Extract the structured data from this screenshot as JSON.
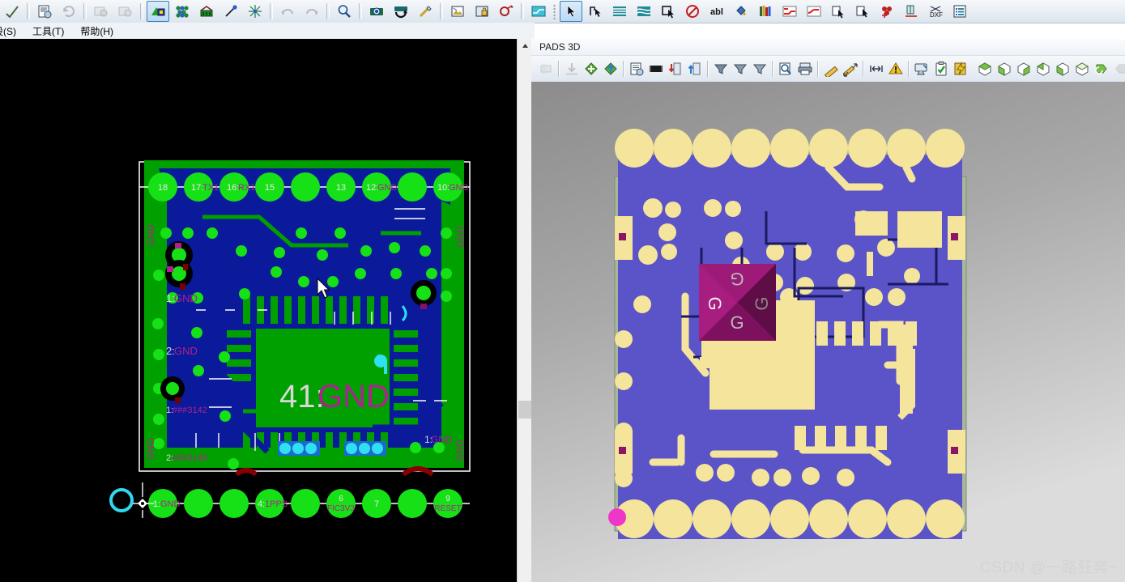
{
  "menubar": {
    "items": [
      {
        "label": "设(S)",
        "accel": "S"
      },
      {
        "label": "工具(T)",
        "accel": "T"
      },
      {
        "label": "帮助(H)",
        "accel": "H"
      }
    ]
  },
  "toolbar": {
    "buttons": [
      {
        "name": "check-tool",
        "icon": "checkmark-icon",
        "enabled": true,
        "selected": false
      },
      {
        "name": "report-tool",
        "icon": "report-icon",
        "enabled": true,
        "selected": false
      },
      {
        "name": "refresh-tool",
        "icon": "refresh-icon",
        "enabled": false,
        "selected": false
      },
      {
        "name": "cam-setup",
        "icon": "camera-gear-icon",
        "enabled": false,
        "selected": false
      },
      {
        "name": "cam-preview",
        "icon": "camera-icon",
        "enabled": false,
        "selected": false
      },
      {
        "name": "plane-tool",
        "icon": "plane-layer-icon",
        "enabled": true,
        "selected": true
      },
      {
        "name": "pour-tool",
        "icon": "copper-pour-icon",
        "enabled": true,
        "selected": false
      },
      {
        "name": "board-outline",
        "icon": "board-outline-icon",
        "enabled": true,
        "selected": false
      },
      {
        "name": "route-tool",
        "icon": "route-line-icon",
        "enabled": true,
        "selected": false
      },
      {
        "name": "fanout-tool",
        "icon": "fanout-icon",
        "enabled": true,
        "selected": false
      },
      {
        "name": "undo",
        "icon": "undo-icon",
        "enabled": false,
        "selected": false
      },
      {
        "name": "redo",
        "icon": "redo-icon",
        "enabled": false,
        "selected": false
      },
      {
        "name": "zoom-tool",
        "icon": "magnifier-icon",
        "enabled": true,
        "selected": false
      },
      {
        "name": "zoom-area",
        "icon": "zoom-area-icon",
        "enabled": true,
        "selected": false
      },
      {
        "name": "rotate-view",
        "icon": "rotate-view-icon",
        "enabled": true,
        "selected": false
      },
      {
        "name": "measure-tool",
        "icon": "ruler-pencil-icon",
        "enabled": true,
        "selected": false
      },
      {
        "name": "image-export",
        "icon": "image-export-icon",
        "enabled": true,
        "selected": false
      },
      {
        "name": "lock-tool",
        "icon": "lock-icon",
        "enabled": true,
        "selected": false
      },
      {
        "name": "query-tool",
        "icon": "query-icon",
        "enabled": true,
        "selected": false
      },
      {
        "name": "netlist-tool",
        "icon": "netlist-icon",
        "enabled": true,
        "selected": false
      },
      {
        "name": "select-arrow",
        "icon": "pointer-icon",
        "enabled": true,
        "selected": true
      },
      {
        "name": "corner-tool",
        "icon": "corner-icon",
        "enabled": true,
        "selected": false
      },
      {
        "name": "layer-tool-a",
        "icon": "layers-a-icon",
        "enabled": true,
        "selected": false
      },
      {
        "name": "layer-tool-b",
        "icon": "layers-b-icon",
        "enabled": true,
        "selected": false
      },
      {
        "name": "move-tool",
        "icon": "move-object-icon",
        "enabled": true,
        "selected": false
      },
      {
        "name": "no-drc",
        "icon": "no-entry-icon",
        "enabled": true,
        "selected": false
      },
      {
        "name": "text-tool",
        "icon": "abl-text-icon",
        "enabled": true,
        "selected": false
      },
      {
        "name": "fill-tool",
        "icon": "paint-bucket-icon",
        "enabled": true,
        "selected": false
      },
      {
        "name": "library-tool",
        "icon": "library-books-icon",
        "enabled": true,
        "selected": false
      },
      {
        "name": "split-plane-a",
        "icon": "split-plane-a-icon",
        "enabled": true,
        "selected": false
      },
      {
        "name": "split-plane-b",
        "icon": "split-plane-b-icon",
        "enabled": true,
        "selected": false
      },
      {
        "name": "copy-object",
        "icon": "copy-object-icon",
        "enabled": true,
        "selected": false
      },
      {
        "name": "paste-object",
        "icon": "paste-object-icon",
        "enabled": true,
        "selected": false
      },
      {
        "name": "via-tool",
        "icon": "via-plus-icon",
        "enabled": true,
        "selected": false
      },
      {
        "name": "dimension-tool",
        "icon": "dimension-icon",
        "enabled": true,
        "selected": false
      },
      {
        "name": "dxf-tool",
        "icon": "dxf-icon",
        "enabled": true,
        "selected": false
      },
      {
        "name": "list-tool",
        "icon": "list-icon",
        "enabled": true,
        "selected": false
      }
    ]
  },
  "pane3d": {
    "title": "PADS 3D",
    "buttons": [
      {
        "name": "board-3d",
        "icon": "board-3d-icon",
        "enabled": false
      },
      {
        "name": "import-3d",
        "icon": "import-down-icon",
        "enabled": false
      },
      {
        "name": "add-3d-model",
        "icon": "add-model-icon",
        "enabled": true
      },
      {
        "name": "export-3d-model",
        "icon": "export-model-icon",
        "enabled": true
      },
      {
        "name": "properties",
        "icon": "properties-icon",
        "enabled": true
      },
      {
        "name": "component-3d",
        "icon": "chip-icon",
        "enabled": true
      },
      {
        "name": "place-down",
        "icon": "place-down-icon",
        "enabled": true
      },
      {
        "name": "place-up",
        "icon": "place-up-icon",
        "enabled": true
      },
      {
        "name": "net-filter-a",
        "icon": "net-filter-a-icon",
        "enabled": true
      },
      {
        "name": "net-filter-b",
        "icon": "net-filter-b-icon",
        "enabled": true
      },
      {
        "name": "net-filter-c",
        "icon": "net-filter-c-icon",
        "enabled": true
      },
      {
        "name": "print-preview",
        "icon": "print-preview-icon",
        "enabled": true
      },
      {
        "name": "print",
        "icon": "printer-icon",
        "enabled": true
      },
      {
        "name": "measure",
        "icon": "ruler-icon",
        "enabled": true
      },
      {
        "name": "measure-diagonal",
        "icon": "ruler-diagonal-icon",
        "enabled": true
      },
      {
        "name": "fit-width",
        "icon": "fit-width-icon",
        "enabled": true
      },
      {
        "name": "clearance-check",
        "icon": "clearance-icon",
        "enabled": true
      },
      {
        "name": "warnings",
        "icon": "warning-triangle-icon",
        "enabled": true
      },
      {
        "name": "display-settings",
        "icon": "display-settings-icon",
        "enabled": true
      },
      {
        "name": "verify-design",
        "icon": "clipboard-check-icon",
        "enabled": true
      },
      {
        "name": "quick-render",
        "icon": "lightning-icon",
        "enabled": true
      },
      {
        "name": "view-iso",
        "icon": "cube-iso-icon",
        "enabled": true
      },
      {
        "name": "view-top",
        "icon": "cube-top-icon",
        "enabled": true
      },
      {
        "name": "view-front",
        "icon": "cube-front-icon",
        "enabled": true
      },
      {
        "name": "view-back",
        "icon": "cube-back-icon",
        "enabled": true
      },
      {
        "name": "view-left",
        "icon": "cube-left-icon",
        "enabled": true
      },
      {
        "name": "view-right",
        "icon": "cube-right-icon",
        "enabled": true
      },
      {
        "name": "rotate-ccw",
        "icon": "rotate-ccw-icon",
        "enabled": true
      },
      {
        "name": "rotate-cw",
        "icon": "rotate-cw-icon",
        "enabled": false
      },
      {
        "name": "fit-screen",
        "icon": "fit-screen-icon",
        "enabled": true
      }
    ],
    "watermark": "CSDN @一路狂奔~"
  },
  "board": {
    "center_label_prefix": "41:",
    "center_label_net": "GND",
    "top_pads": [
      {
        "num": "18",
        "net": ""
      },
      {
        "num": "17:",
        "net": "TX1"
      },
      {
        "num": "16:",
        "net": "RX1"
      },
      {
        "num": "15",
        "net": ""
      },
      {
        "num": "",
        "net": ""
      },
      {
        "num": "13",
        "net": ""
      },
      {
        "num": "12:",
        "net": "GND"
      },
      {
        "num": "",
        "net": ""
      },
      {
        "num": "10:",
        "net": "GND"
      }
    ],
    "bottom_pads": [
      {
        "num": "1:",
        "net": "GND"
      },
      {
        "num": "",
        "net": ""
      },
      {
        "num": "",
        "net": ""
      },
      {
        "num": "4:",
        "net": "1PPS"
      },
      {
        "num": "",
        "net": ""
      },
      {
        "num": "6",
        "net": "FIC3V3"
      },
      {
        "num": "7",
        "net": ""
      },
      {
        "num": "",
        "net": ""
      },
      {
        "num": "9",
        "net": "RESET"
      }
    ],
    "left_labels": [
      {
        "text": "GND",
        "vertical": true
      },
      {
        "text": "1:GND",
        "vertical": false
      },
      {
        "text": "2:GND",
        "vertical": false
      },
      {
        "text": "1:###3142",
        "vertical": false
      },
      {
        "text": "2:###3148",
        "vertical": false
      },
      {
        "text": "GND",
        "vertical": true
      }
    ],
    "right_labels": [
      {
        "text": "GND",
        "vertical": true
      },
      {
        "text": "1:GND",
        "vertical": false
      },
      {
        "text": "GND",
        "vertical": true
      }
    ],
    "colors": {
      "background": "#000000",
      "copper_top": "#00a000",
      "plane": "#0a1a9a",
      "pad": "#16e016",
      "silkscreen": "#ffffff",
      "net_label": "#b02090",
      "highlight_cyan": "#30e0f0",
      "drill_red": "#a00000"
    }
  },
  "view3d": {
    "colors": {
      "background_top": "#8e8e8e",
      "background_bottom": "#d7d7d7",
      "soldermask": "#5b53c8",
      "copper": "#f5e49b",
      "edge": "#9aab8e",
      "marker_magenta": "#8e1468",
      "pin1_dot": "#ee37c8"
    },
    "marker_letters": [
      "G",
      "G",
      "G",
      "G"
    ]
  }
}
